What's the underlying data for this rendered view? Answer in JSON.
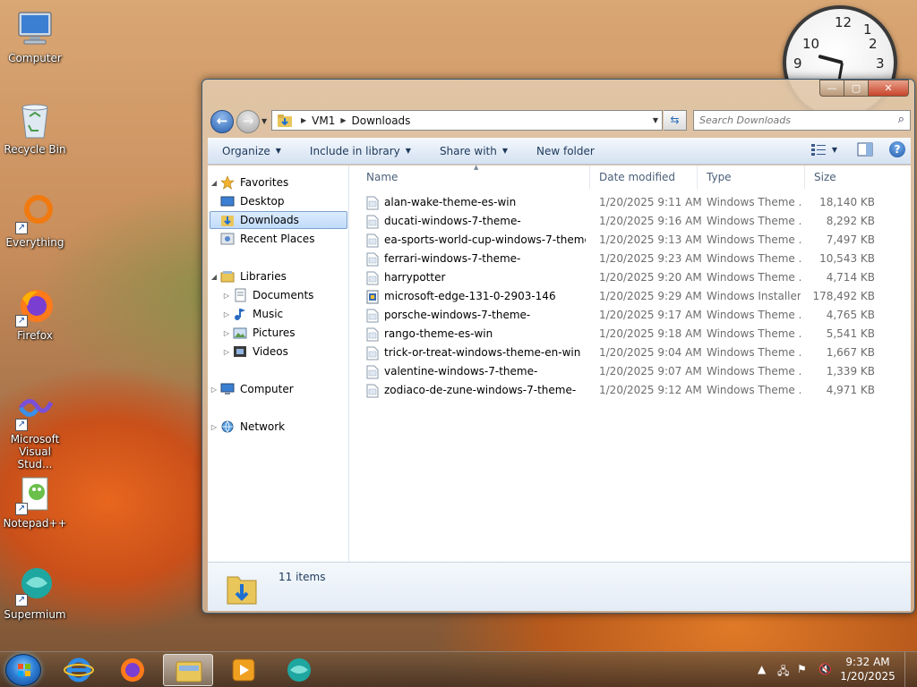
{
  "desktop": {
    "icons": [
      {
        "label": "Computer"
      },
      {
        "label": "Recycle Bin"
      },
      {
        "label": "Everything"
      },
      {
        "label": "Firefox"
      },
      {
        "label": "Microsoft Visual Stud..."
      },
      {
        "label": "Notepad++"
      },
      {
        "label": "Supermium"
      }
    ]
  },
  "clock_gadget": {
    "numbers": [
      "12",
      "1",
      "2",
      "3",
      "9",
      "10"
    ]
  },
  "window": {
    "controls": {
      "minimize": "—",
      "maximize": "▢",
      "close": "✕"
    },
    "address": {
      "crumbs": [
        "VM1",
        "Downloads"
      ],
      "search_placeholder": "Search Downloads"
    },
    "toolbar": {
      "organize": "Organize",
      "include_in_library": "Include in library",
      "share_with": "Share with",
      "new_folder": "New folder"
    },
    "nav": {
      "favorites": "Favorites",
      "desktop": "Desktop",
      "downloads": "Downloads",
      "recent_places": "Recent Places",
      "libraries": "Libraries",
      "documents": "Documents",
      "music": "Music",
      "pictures": "Pictures",
      "videos": "Videos",
      "computer": "Computer",
      "network": "Network"
    },
    "columns": {
      "name": "Name",
      "date_modified": "Date modified",
      "type": "Type",
      "size": "Size"
    },
    "files": [
      {
        "name": "alan-wake-theme-es-win",
        "date": "1/20/2025 9:11 AM",
        "type": "Windows Theme ...",
        "size": "18,140 KB"
      },
      {
        "name": "ducati-windows-7-theme-",
        "date": "1/20/2025 9:16 AM",
        "type": "Windows Theme ...",
        "size": "8,292 KB"
      },
      {
        "name": "ea-sports-world-cup-windows-7-theme-",
        "date": "1/20/2025 9:13 AM",
        "type": "Windows Theme ...",
        "size": "7,497 KB"
      },
      {
        "name": "ferrari-windows-7-theme-",
        "date": "1/20/2025 9:23 AM",
        "type": "Windows Theme ...",
        "size": "10,543 KB"
      },
      {
        "name": "harrypotter",
        "date": "1/20/2025 9:20 AM",
        "type": "Windows Theme ...",
        "size": "4,714 KB"
      },
      {
        "name": "microsoft-edge-131-0-2903-146",
        "date": "1/20/2025 9:29 AM",
        "type": "Windows Installer ...",
        "size": "178,492 KB"
      },
      {
        "name": "porsche-windows-7-theme-",
        "date": "1/20/2025 9:17 AM",
        "type": "Windows Theme ...",
        "size": "4,765 KB"
      },
      {
        "name": "rango-theme-es-win",
        "date": "1/20/2025 9:18 AM",
        "type": "Windows Theme ...",
        "size": "5,541 KB"
      },
      {
        "name": "trick-or-treat-windows-theme-en-win",
        "date": "1/20/2025 9:04 AM",
        "type": "Windows Theme ...",
        "size": "1,667 KB"
      },
      {
        "name": "valentine-windows-7-theme-",
        "date": "1/20/2025 9:07 AM",
        "type": "Windows Theme ...",
        "size": "1,339 KB"
      },
      {
        "name": "zodiaco-de-zune-windows-7-theme-",
        "date": "1/20/2025 9:12 AM",
        "type": "Windows Theme ...",
        "size": "4,971 KB"
      }
    ],
    "status": {
      "item_count": "11 items"
    }
  },
  "taskbar": {
    "time": "9:32 AM",
    "date": "1/20/2025"
  },
  "colors": {
    "accent": "#1e395b",
    "selection": "#c1dbfc"
  }
}
